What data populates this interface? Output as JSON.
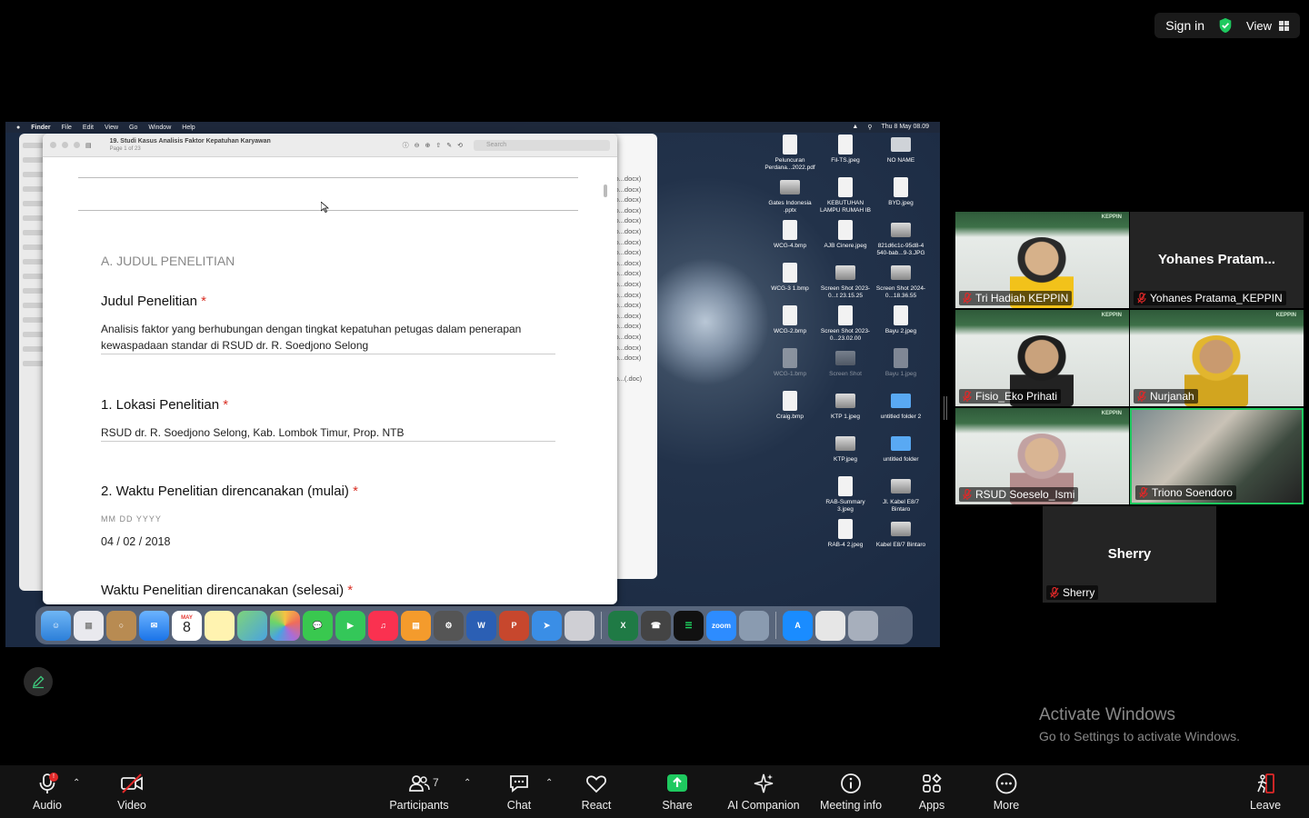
{
  "topbar": {
    "sign_in": "Sign in",
    "view": "View"
  },
  "mac": {
    "menu": [
      "Finder",
      "File",
      "Edit",
      "View",
      "Go",
      "Window",
      "Help"
    ],
    "clock": "Thu 8 May  08.09"
  },
  "doc": {
    "title": "19. Studi Kasus Analisis Faktor Kepatuhan Karyawan",
    "page": "Page 1 of 23",
    "search_placeholder": "Search",
    "section": "A. JUDUL PENELITIAN",
    "q1": "Judul Penelitian",
    "a1": "Analisis faktor yang berhubungan dengan tingkat kepatuhan petugas dalam penerapan kewaspadaan standar di RSUD dr. R. Soedjono Selong",
    "q2": "1. Lokasi Penelitian",
    "a2": "RSUD dr. R. Soedjono Selong, Kab. Lombok Timur, Prop. NTB",
    "q3": "2. Waktu Penelitian direncanakan (mulai)",
    "date_caption": "MM    DD    YYYY",
    "date_value": "04 / 02 / 2018",
    "q4": "Waktu Penelitian direncanakan (selesai)",
    "required_mark": "*"
  },
  "list_rows": [
    "ro...docx)",
    "ro...docx)",
    "ro...docx)",
    "ro...docx)",
    "ro...docx)",
    "ro...docx)",
    "ro...docx)",
    "ro...docx)",
    "ro...docx)",
    "ro...docx)",
    "ro...docx)",
    "ro...docx)",
    "ro...docx)",
    "ro...docx)",
    "ro...docx)",
    "ro...docx)",
    "ro...docx)",
    "ro...docx)",
    "",
    "ro...(.doc)"
  ],
  "desktop_icons": [
    {
      "label": "Peluncuran Perdana...2022.pdf",
      "kind": "doc"
    },
    {
      "label": "Fil-TS.jpeg",
      "kind": "doc"
    },
    {
      "label": "NO NAME",
      "kind": "disk"
    },
    {
      "label": "Gates Indonesia .pptx",
      "kind": "img"
    },
    {
      "label": "KEBUTUHAN LAMPU RUMAH IB",
      "kind": "doc"
    },
    {
      "label": "BYD.jpeg",
      "kind": "doc"
    },
    {
      "label": "WCG-4.bmp",
      "kind": "doc"
    },
    {
      "label": "AJB Cinere.jpeg",
      "kind": "doc"
    },
    {
      "label": "821d6c1c-95d8-4 540-bab...9-3.JPG",
      "kind": "img"
    },
    {
      "label": "WCG-3 1.bmp",
      "kind": "doc"
    },
    {
      "label": "Screen Shot 2023-0...t 23.15.25",
      "kind": "img"
    },
    {
      "label": "Screen Shot 2024-0...18.36.55",
      "kind": "img"
    },
    {
      "label": "WCG-2.bmp",
      "kind": "doc"
    },
    {
      "label": "Screen Shot 2023-0...23.02.00",
      "kind": "doc"
    },
    {
      "label": "Bayu 2.jpeg",
      "kind": "doc"
    },
    {
      "label": "WCG-1.bmp",
      "kind": "doc"
    },
    {
      "label": "Screen Shot",
      "kind": "img"
    },
    {
      "label": "Bayu 1.jpeg",
      "kind": "doc"
    },
    {
      "label": "Craig.bmp",
      "kind": "doc"
    },
    {
      "label": "KTP 1.jpeg",
      "kind": "img"
    },
    {
      "label": "untitled folder 2",
      "kind": "folder"
    },
    {
      "label": "KTP.jpeg",
      "kind": "img"
    },
    {
      "label": "untitled folder",
      "kind": "folder"
    },
    {
      "label": "RAB-Summary 3.jpeg",
      "kind": "doc"
    },
    {
      "label": "Jl. Kabel E8/7 Bintaro",
      "kind": "img"
    },
    {
      "label": "RAB-4 2.jpeg",
      "kind": "doc"
    },
    {
      "label": "Kabel E8/7 Bintaro",
      "kind": "img"
    }
  ],
  "calendar": {
    "month": "MAY",
    "day": "8"
  },
  "zoom_dock_label": "zoom",
  "participants": [
    {
      "name": "Tri Hadiah KEPPIN",
      "big": ""
    },
    {
      "name": "Yohanes Pratama_KEPPIN",
      "big": "Yohanes  Pratam..."
    },
    {
      "name": "Fisio_Eko Prihati",
      "big": ""
    },
    {
      "name": "Nurjanah",
      "big": ""
    },
    {
      "name": "RSUD Soeselo_Ismi",
      "big": ""
    },
    {
      "name": "Triono Soendoro",
      "big": ""
    },
    {
      "name": "Sherry",
      "big": "Sherry"
    }
  ],
  "banner_text": "KEPPIN",
  "activate": {
    "line1": "Activate Windows",
    "line2": "Go to Settings to activate Windows."
  },
  "toolbar": {
    "audio": "Audio",
    "audio_badge": "!",
    "video": "Video",
    "participants": "Participants",
    "participants_count": "7",
    "chat": "Chat",
    "react": "React",
    "share": "Share",
    "ai": "AI Companion",
    "meeting_info": "Meeting info",
    "apps": "Apps",
    "more": "More",
    "leave": "Leave"
  },
  "colors": {
    "share_green": "#1ec95f",
    "leave_red": "#e02828",
    "required_red": "#d93025"
  }
}
